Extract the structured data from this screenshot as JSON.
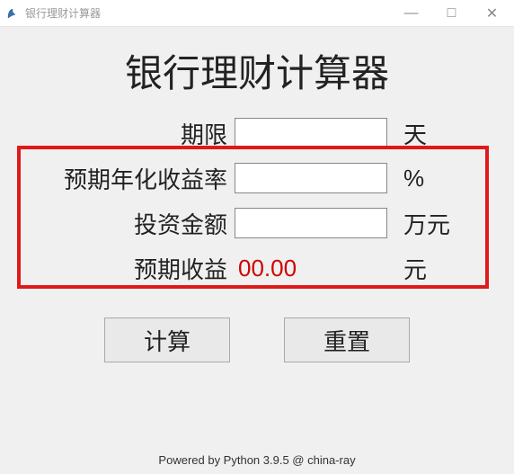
{
  "window": {
    "title": "银行理财计算器",
    "controls": {
      "min": "—",
      "max": "□",
      "close": "✕"
    }
  },
  "page": {
    "title": "银行理财计算器"
  },
  "form": {
    "rows": [
      {
        "label": "期限",
        "value": "",
        "unit": "天"
      },
      {
        "label": "预期年化收益率",
        "value": "",
        "unit": "%"
      },
      {
        "label": "投资金额",
        "value": "",
        "unit": "万元"
      }
    ],
    "result": {
      "label": "预期收益",
      "value": "00.00",
      "unit": "元"
    }
  },
  "buttons": {
    "calc": "计算",
    "reset": "重置"
  },
  "footer": "Powered by Python 3.9.5 @ china-ray"
}
